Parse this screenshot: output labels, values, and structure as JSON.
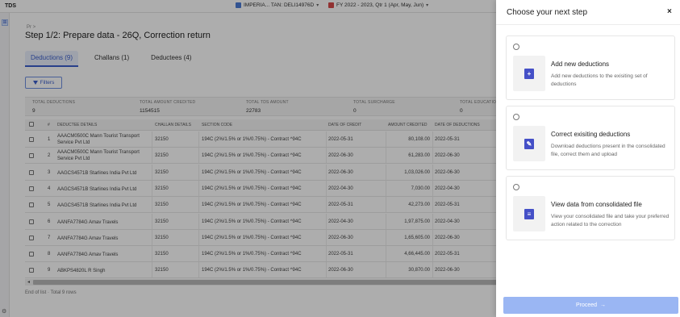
{
  "app": {
    "title": "TDS"
  },
  "header": {
    "org": "IMPERIA... TAN: DELI14976D",
    "fy": "FY 2022 - 2023, Qtr 1 (Apr, May, Jun)"
  },
  "page": {
    "breadcrumb": "Pr >",
    "title": "Step 1/2: Prepare data - 26Q, Correction return"
  },
  "tabs": [
    {
      "label": "Deductions (9)",
      "active": true
    },
    {
      "label": "Challans (1)",
      "active": false
    },
    {
      "label": "Deductees (4)",
      "active": false
    }
  ],
  "filters_label": "Filters",
  "summary": [
    {
      "label": "TOTAL DEDUCTIONS",
      "value": "9"
    },
    {
      "label": "TOTAL AMOUNT CREDITED",
      "value": "1154515"
    },
    {
      "label": "TOTAL TDS AMOUNT",
      "value": "22783"
    },
    {
      "label": "TOTAL SURCHARGE",
      "value": "0"
    },
    {
      "label": "TOTAL EDUCATION",
      "value": "0"
    }
  ],
  "table": {
    "headers": [
      "#",
      "DEDUCTEE DETAILS",
      "CHALLAN DETAILS",
      "SECTION CODE",
      "DATE OF CREDIT",
      "AMOUNT CREDITED",
      "DATE OF DEDUCTIONS"
    ],
    "rows": [
      {
        "n": "1",
        "deductee": "AAACM0500C Mann Tourist Transport Service Pvt Ltd",
        "challan": "32150",
        "section": "194C (2%/1.5% or 1%/0.75%) - Contract ^94C",
        "credit_date": "2022-05-31",
        "amount": "80,108.00",
        "ded_date": "2022-05-31"
      },
      {
        "n": "2",
        "deductee": "AAACM0500C Mann Tourist Transport Service Pvt Ltd",
        "challan": "32150",
        "section": "194C (2%/1.5% or 1%/0.75%) - Contract ^94C",
        "credit_date": "2022-06-30",
        "amount": "61,283.00",
        "ded_date": "2022-06-30"
      },
      {
        "n": "3",
        "deductee": "AAGCS4571B Starlines India Pvt Ltd",
        "challan": "32150",
        "section": "194C (2%/1.5% or 1%/0.75%) - Contract ^94C",
        "credit_date": "2022-06-30",
        "amount": "1,03,026.00",
        "ded_date": "2022-06-30"
      },
      {
        "n": "4",
        "deductee": "AAGCS4571B Starlines India Pvt Ltd",
        "challan": "32150",
        "section": "194C (2%/1.5% or 1%/0.75%) - Contract ^94C",
        "credit_date": "2022-04-30",
        "amount": "7,030.00",
        "ded_date": "2022-04-30"
      },
      {
        "n": "5",
        "deductee": "AAGCS4571B Starlines India Pvt Ltd",
        "challan": "32150",
        "section": "194C (2%/1.5% or 1%/0.75%) - Contract ^94C",
        "credit_date": "2022-05-31",
        "amount": "42,273.00",
        "ded_date": "2022-05-31"
      },
      {
        "n": "6",
        "deductee": "AANFA7784G Amav Travels",
        "challan": "32150",
        "section": "194C (2%/1.5% or 1%/0.75%) - Contract ^94C",
        "credit_date": "2022-04-30",
        "amount": "1,97,875.00",
        "ded_date": "2022-04-30"
      },
      {
        "n": "7",
        "deductee": "AANFA7784G Amav Travels",
        "challan": "32150",
        "section": "194C (2%/1.5% or 1%/0.75%) - Contract ^94C",
        "credit_date": "2022-06-30",
        "amount": "1,65,605.00",
        "ded_date": "2022-06-30"
      },
      {
        "n": "8",
        "deductee": "AANFA7784G Amav Travels",
        "challan": "32150",
        "section": "194C (2%/1.5% or 1%/0.75%) - Contract ^94C",
        "credit_date": "2022-05-31",
        "amount": "4,66,445.00",
        "ded_date": "2022-05-31"
      },
      {
        "n": "9",
        "deductee": "ABKPS4820L R Singh",
        "challan": "32150",
        "section": "194C (2%/1.5% or 1%/0.75%) - Contract ^94C",
        "credit_date": "2022-06-30",
        "amount": "30,870.00",
        "ded_date": "2022-06-30"
      }
    ]
  },
  "footer": "End of list · Total 9 rows",
  "panel": {
    "title": "Choose your next step",
    "close_glyph": "×",
    "options": [
      {
        "title": "Add new deductions",
        "desc": "Add new deductions to the exisiting set of deductions",
        "icon": "add-document-icon"
      },
      {
        "title": "Correct exisiting deductions",
        "desc": "Download deductions present in the consolidated file, correct them and upload",
        "icon": "edit-icon"
      },
      {
        "title": "View data from consolidated file",
        "desc": "View your consolidated file and take your preferred action related to the correction",
        "icon": "clipboard-icon"
      }
    ],
    "proceed_label": "Proceed",
    "proceed_arrow": "→",
    "colors": {
      "accent": "#4550c7",
      "proceed_bg": "#9ab6f3"
    }
  }
}
